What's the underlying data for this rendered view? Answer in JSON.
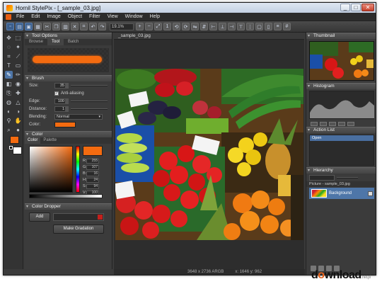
{
  "window": {
    "title": "Hornil StylePix - [_sample_03.jpg]",
    "buttons": [
      "_",
      "□",
      "✕"
    ]
  },
  "menu": [
    "File",
    "Edit",
    "Image",
    "Object",
    "Filter",
    "View",
    "Window",
    "Help"
  ],
  "toolbar": {
    "zoom": "19.1%"
  },
  "tool_options": {
    "header": "Tool Options",
    "tabs": [
      "Browse",
      "Tool",
      "Batch"
    ],
    "active_tab": "Tool",
    "brush_header": "Brush",
    "size_label": "Size:",
    "size_value": "35",
    "antialias_label": "Anti-aliasing",
    "antialias_checked": "✓",
    "edge_label": "Edge:",
    "edge_value": "100",
    "distance_label": "Distance:",
    "distance_value": "1",
    "blending_label": "Blending:",
    "blending_value": "Normal",
    "color_label": "Color:",
    "brush_color": "#f46b10"
  },
  "color_panel": {
    "header": "Color",
    "tabs": [
      "Color",
      "Palette"
    ],
    "active_tab": "Color",
    "channels": [
      {
        "name": "R:",
        "value": "255"
      },
      {
        "name": "G:",
        "value": "107"
      },
      {
        "name": "B:",
        "value": "16"
      },
      {
        "name": "H:",
        "value": "24"
      },
      {
        "name": "S:",
        "value": "94"
      },
      {
        "name": "V:",
        "value": "100"
      }
    ]
  },
  "color_dropper": {
    "header": "Color Dropper",
    "add_label": "Add",
    "gradation_label": "Make Gradation"
  },
  "document": {
    "tab": "_sample_03.jpg",
    "size": "3648 x 2736 ARGB",
    "coords": "x: 1646 y: 962"
  },
  "right": {
    "thumbnail_header": "Thumbnail",
    "histogram_header": "Histogram",
    "action_header": "Action List",
    "action_item": "Open",
    "hierarchy_header": "Hierarchy",
    "hierarchy_title": "Picture - sample_03.jpg",
    "layer_name": "Background"
  },
  "watermark": {
    "pre": "d",
    "o": "o",
    "post": "wnload",
    "suffix": ".net.pl"
  }
}
